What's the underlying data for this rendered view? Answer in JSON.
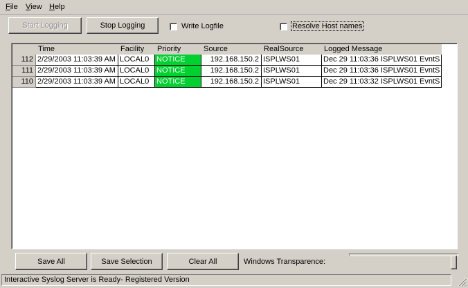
{
  "menu": {
    "file": {
      "u": "F",
      "rest": "ile"
    },
    "view": {
      "u": "V",
      "rest": "iew"
    },
    "help": {
      "u": "H",
      "rest": "elp"
    }
  },
  "toolbar": {
    "start_logging": "Start Logging",
    "stop_logging": "Stop Logging",
    "write_logfile": "Write Logfile",
    "resolve_host_names": "Resolve Host names"
  },
  "grid": {
    "columns": [
      "Time",
      "Facility",
      "Priority",
      "Source",
      "RealSource",
      "Logged Message"
    ],
    "rows": [
      {
        "id": "112",
        "time": "2/29/2003 11:03:39 AM",
        "facility": "LOCAL0",
        "priority": "NOTICE",
        "source": "192.168.150.2",
        "realsource": "ISPLWS01",
        "message": "Dec 29 11:03:36 ISPLWS01 EvntS"
      },
      {
        "id": "111",
        "time": "2/29/2003 11:03:39 AM",
        "facility": "LOCAL0",
        "priority": "NOTICE",
        "source": "192.168.150.2",
        "realsource": "ISPLWS01",
        "message": "Dec 29 11:03:36 ISPLWS01 EvntS"
      },
      {
        "id": "110",
        "time": "2/29/2003 11:03:39 AM",
        "facility": "LOCAL0",
        "priority": "NOTICE",
        "source": "192.168.150.2",
        "realsource": "ISPLWS01",
        "message": "Dec 29 11:03:32 ISPLWS01 EvntS"
      }
    ]
  },
  "bottom": {
    "save_all": "Save All",
    "save_selection": "Save Selection",
    "clear_all": "Clear All",
    "transparence_label": "Windows Transparence:",
    "transparence_value": 1.0
  },
  "status": {
    "text": "Interactive Syslog Server is Ready- Registered Version"
  },
  "colors": {
    "notice_bg": "#00d030",
    "window_bg": "#d4d0c8"
  }
}
